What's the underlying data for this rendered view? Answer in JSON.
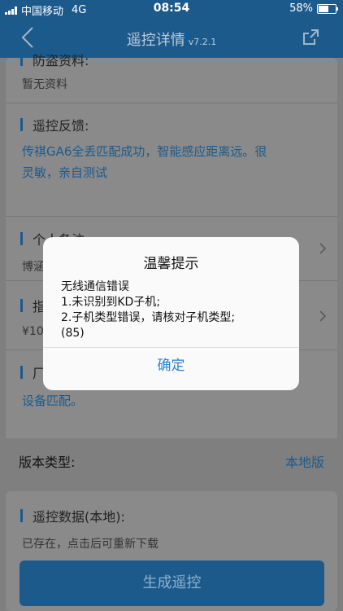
{
  "status_bar": {
    "carrier": "中国移动",
    "network": "4G",
    "time": "08:54",
    "battery_percent": "58%",
    "battery_level": 0.58
  },
  "nav": {
    "title": "遥控详情",
    "version": "v7.2.1",
    "back_icon": "chevron-left-icon",
    "share_icon": "share-icon"
  },
  "sections": {
    "anti_theft_data": {
      "heading": "防盗资料:",
      "value": "暂无资料"
    },
    "remote_feedback": {
      "heading": "遥控反馈:",
      "line1": "传祺GA6全丢匹配成功，智能感应距离远。很",
      "line2": "灵敏，亲自测试"
    },
    "personal_note": {
      "heading": "个人备注:",
      "value": "博涵"
    },
    "guide": {
      "heading": "指",
      "value": "¥10"
    },
    "factory": {
      "heading": "厂",
      "value": "设备匹配。"
    },
    "version_type": {
      "label": "版本类型:",
      "value": "本地版"
    },
    "remote_data": {
      "heading": "遥控数据(本地):",
      "value": "已存在，点击后可重新下载"
    }
  },
  "generate_button": "生成遥控",
  "dialog": {
    "title": "温馨提示",
    "line1": "无线通信错误",
    "line2": "1.未识别到KD子机;",
    "line3": "2.子机类型错误，请核对子机类型;",
    "line4": "(85)",
    "confirm": "确定"
  },
  "colors": {
    "accent": "#2a7fd0",
    "overlay_dim": "#7f7f7f",
    "nav_dim": "#1d5a8c"
  }
}
